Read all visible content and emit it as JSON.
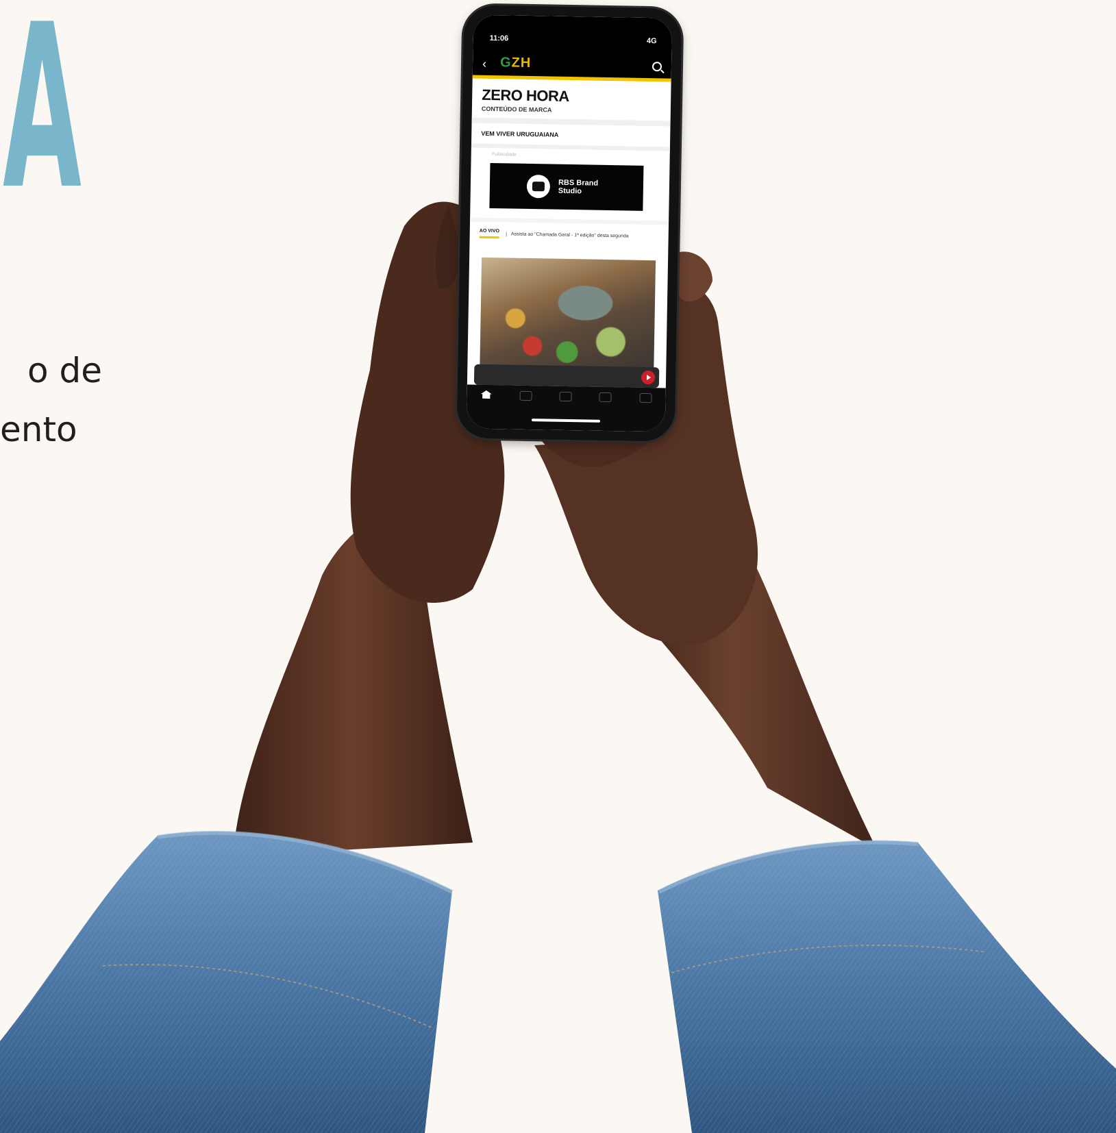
{
  "headline": {
    "letter": "A",
    "color": "#79b6cb"
  },
  "caption": {
    "line1": "o de",
    "line2": "ento"
  },
  "phone": {
    "status_time": "11:06",
    "status_signal": "4G",
    "app_logo": "GZH",
    "brand_title": "ZERO HORA",
    "brand_subtitle": "CONTEÚDO DE MARCA",
    "section_title": "VEM VIVER URUGUAIANA",
    "ad_small_label": "Publicidade",
    "ad_text": "RBS Brand Studio",
    "live_label": "AO VIVO",
    "live_text": "Assista ao \"Chamada Geral - 1ª edição\" desta segunda",
    "accent_yellow": "#f2c300",
    "play_color": "#d11f2a"
  },
  "scene": {
    "skin": "#5a3424",
    "denim": "#4b78a6"
  }
}
